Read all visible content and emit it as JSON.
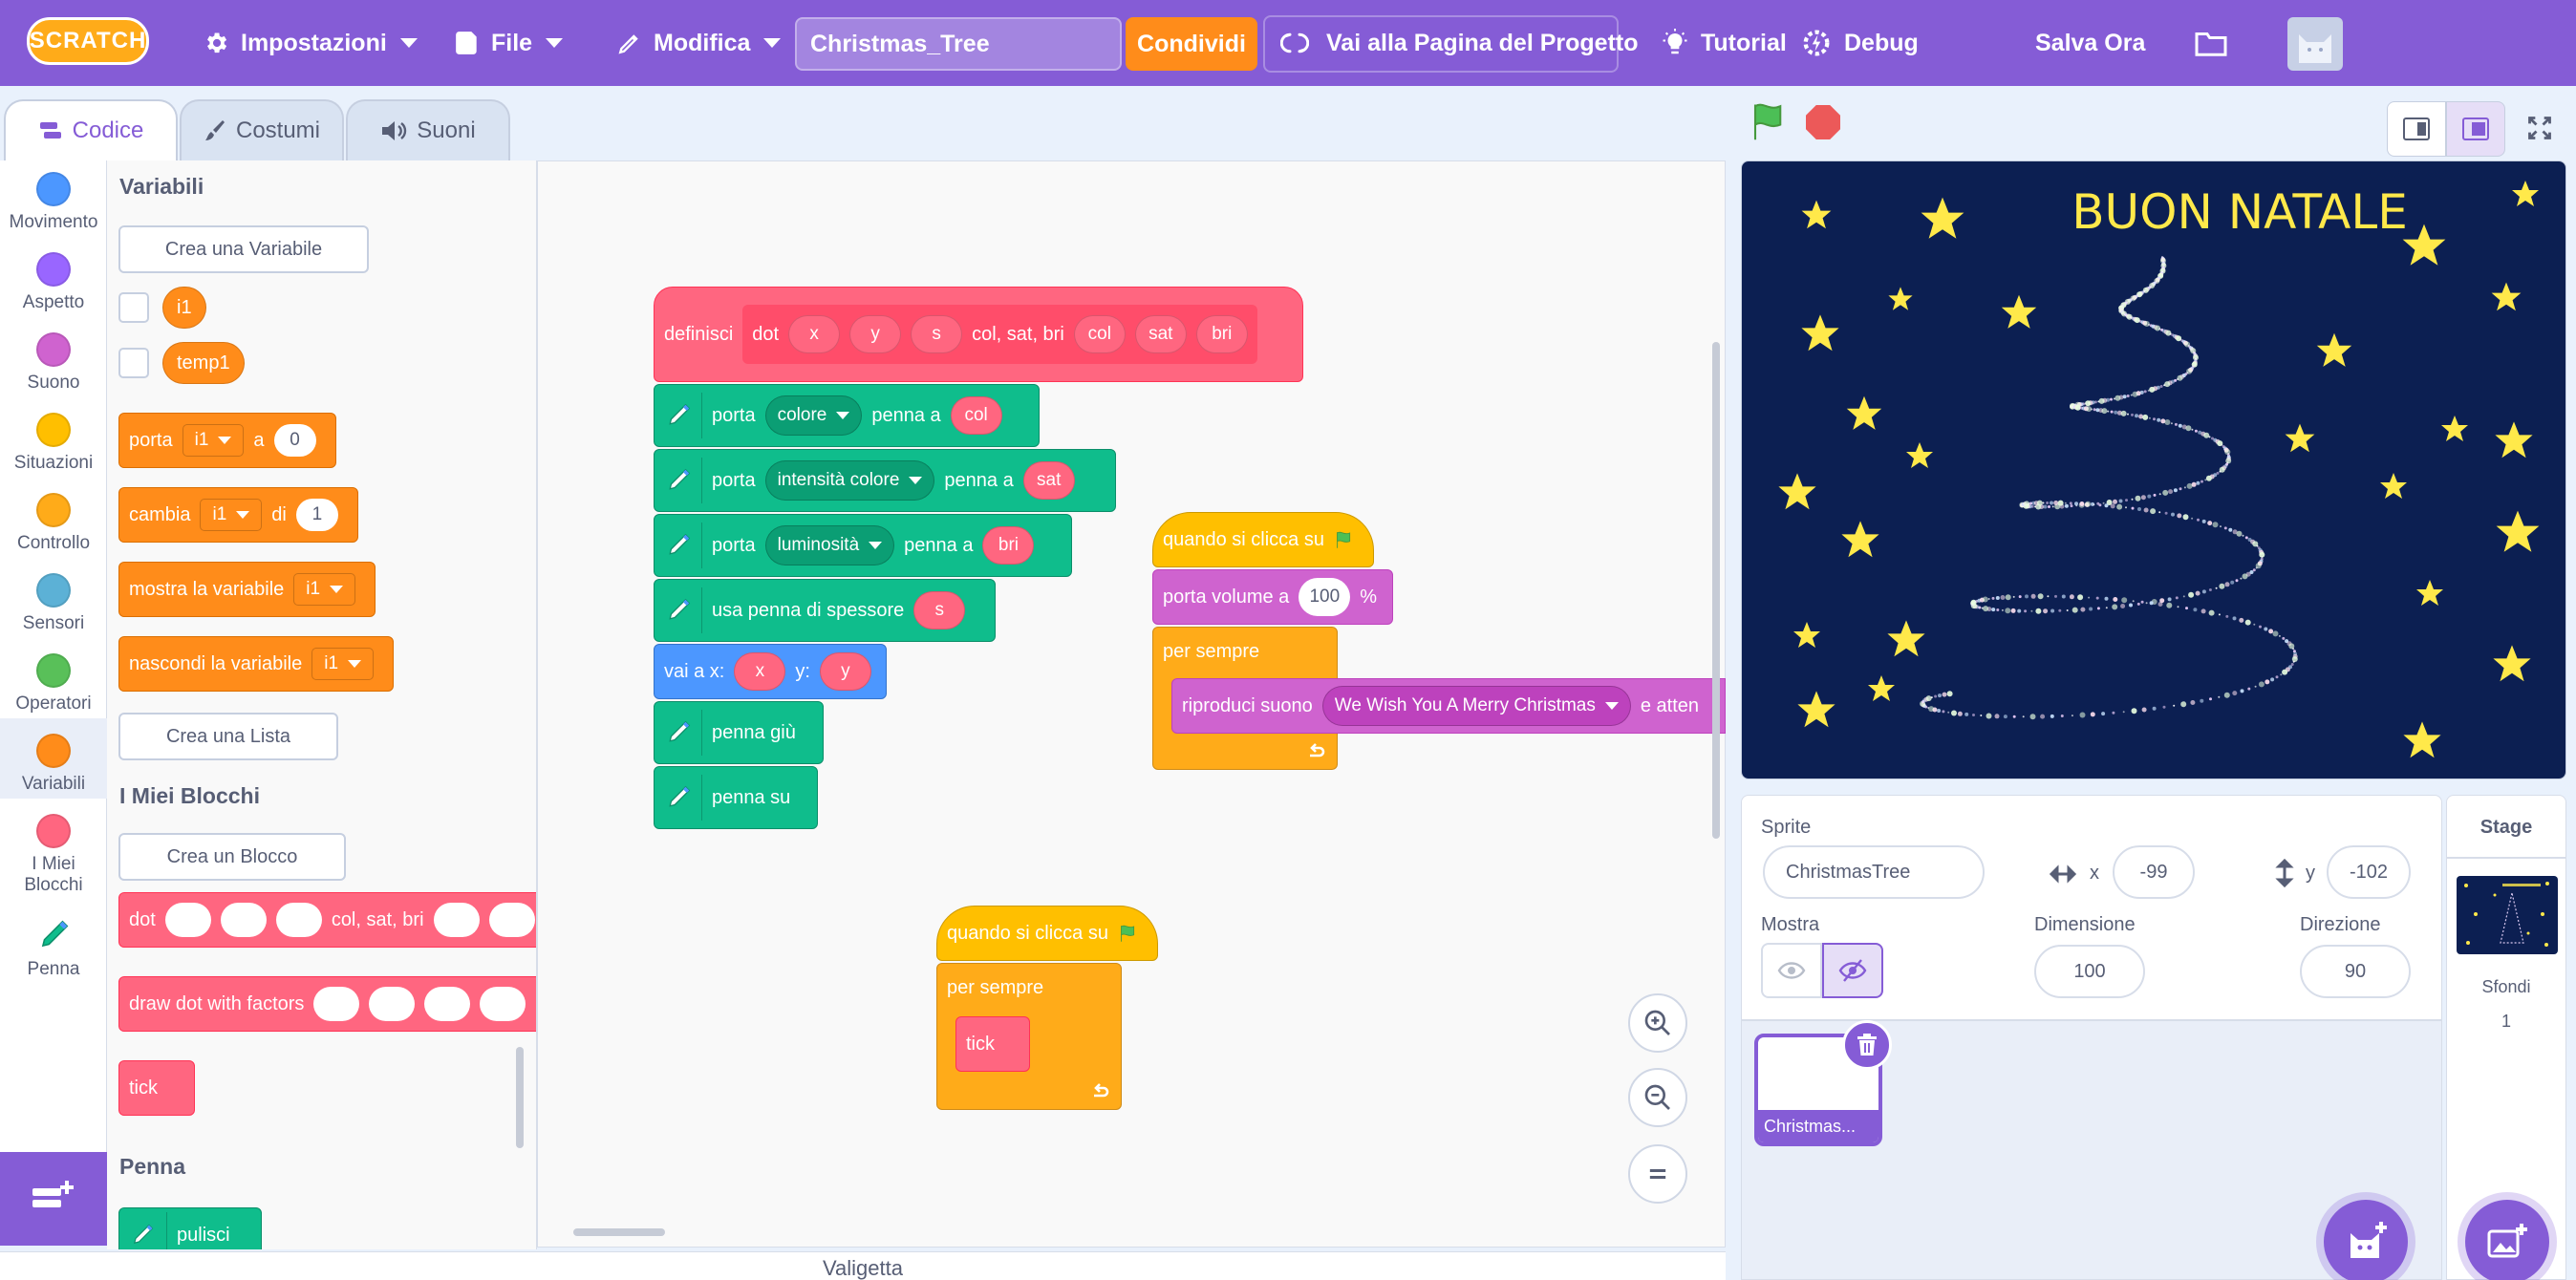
{
  "menubar": {
    "logo_text": "SCRATCH",
    "settings": "Impostazioni",
    "file": "File",
    "edit": "Modifica",
    "project_title": "Christmas_Tree",
    "share": "Condividi",
    "project_page": "Vai alla Pagina del Progetto",
    "tutorials": "Tutorial",
    "debug": "Debug",
    "save_now": "Salva Ora"
  },
  "tabs": {
    "code": "Codice",
    "costumes": "Costumi",
    "sounds": "Suoni"
  },
  "categories": [
    {
      "label": "Movimento",
      "color": "#4c97ff"
    },
    {
      "label": "Aspetto",
      "color": "#9966ff"
    },
    {
      "label": "Suono",
      "color": "#cf63cf"
    },
    {
      "label": "Situazioni",
      "color": "#ffbf00"
    },
    {
      "label": "Controllo",
      "color": "#ffab19"
    },
    {
      "label": "Sensori",
      "color": "#5cb1d6"
    },
    {
      "label": "Operatori",
      "color": "#59c059"
    },
    {
      "label": "Variabili",
      "color": "#ff8c1a"
    },
    {
      "label_1": "I Miei",
      "label_2": "Blocchi",
      "color": "#ff6680"
    },
    {
      "label": "Penna"
    }
  ],
  "palette": {
    "variables_heading": "Variabili",
    "make_variable": "Crea una Variabile",
    "var1": "i1",
    "var2": "temp1",
    "set_label": "porta",
    "set_var": "i1",
    "set_to": "a",
    "set_value": "0",
    "change_label": "cambia",
    "change_var": "i1",
    "change_by": "di",
    "change_value": "1",
    "show_var_label": "mostra la variabile",
    "show_var": "i1",
    "hide_var_label": "nascondi la variabile",
    "hide_var": "i1",
    "make_list": "Crea una Lista",
    "my_blocks_heading": "I Miei Blocchi",
    "make_block": "Crea un Blocco",
    "dot_label": "dot",
    "dot_mid": "col, sat, bri",
    "draw_dot_label": "draw dot with factors",
    "tick_label": "tick",
    "pen_heading": "Penna",
    "erase_all": "pulisci"
  },
  "script_define": {
    "define": "definisci",
    "name": "dot",
    "params": [
      "x",
      "y",
      "s"
    ],
    "mid_text": "col, sat, bri",
    "params2": [
      "col",
      "sat",
      "bri"
    ],
    "set_pen": "porta",
    "to_pen": "penna a",
    "color_dd": "colore",
    "color_val": "col",
    "sat_dd": "intensità colore",
    "sat_val": "sat",
    "bri_dd": "luminosità",
    "bri_val": "bri",
    "pen_size": "usa penna di spessore",
    "size_val": "s",
    "goto": "vai a x:",
    "goto_x": "x",
    "goto_y_label": "y:",
    "goto_y": "y",
    "pen_down": "penna giù",
    "pen_up": "penna su"
  },
  "script_sound": {
    "hat": "quando si clicca su",
    "volume": "porta volume a",
    "volume_val": "100",
    "volume_unit": "%",
    "forever": "per sempre",
    "play": "riproduci suono",
    "sound": "We Wish You A Merry Christmas",
    "until": "e atten"
  },
  "script_tick": {
    "hat": "quando si clicca su",
    "forever": "per sempre",
    "call": "tick"
  },
  "stage": {
    "title": "BUON NATALE"
  },
  "sprite_info": {
    "sprite_label": "Sprite",
    "sprite_name": "ChristmasTree",
    "x_label": "x",
    "x": "-99",
    "y_label": "y",
    "y": "-102",
    "show_label": "Mostra",
    "size_label": "Dimensione",
    "size": "100",
    "direction_label": "Direzione",
    "direction": "90"
  },
  "sprite_list": {
    "thumb_label": "Christmas..."
  },
  "stage_panel": {
    "title": "Stage",
    "backdrops_label": "Sfondi",
    "backdrops_count": "1"
  },
  "backpack": {
    "label": "Valigetta"
  }
}
